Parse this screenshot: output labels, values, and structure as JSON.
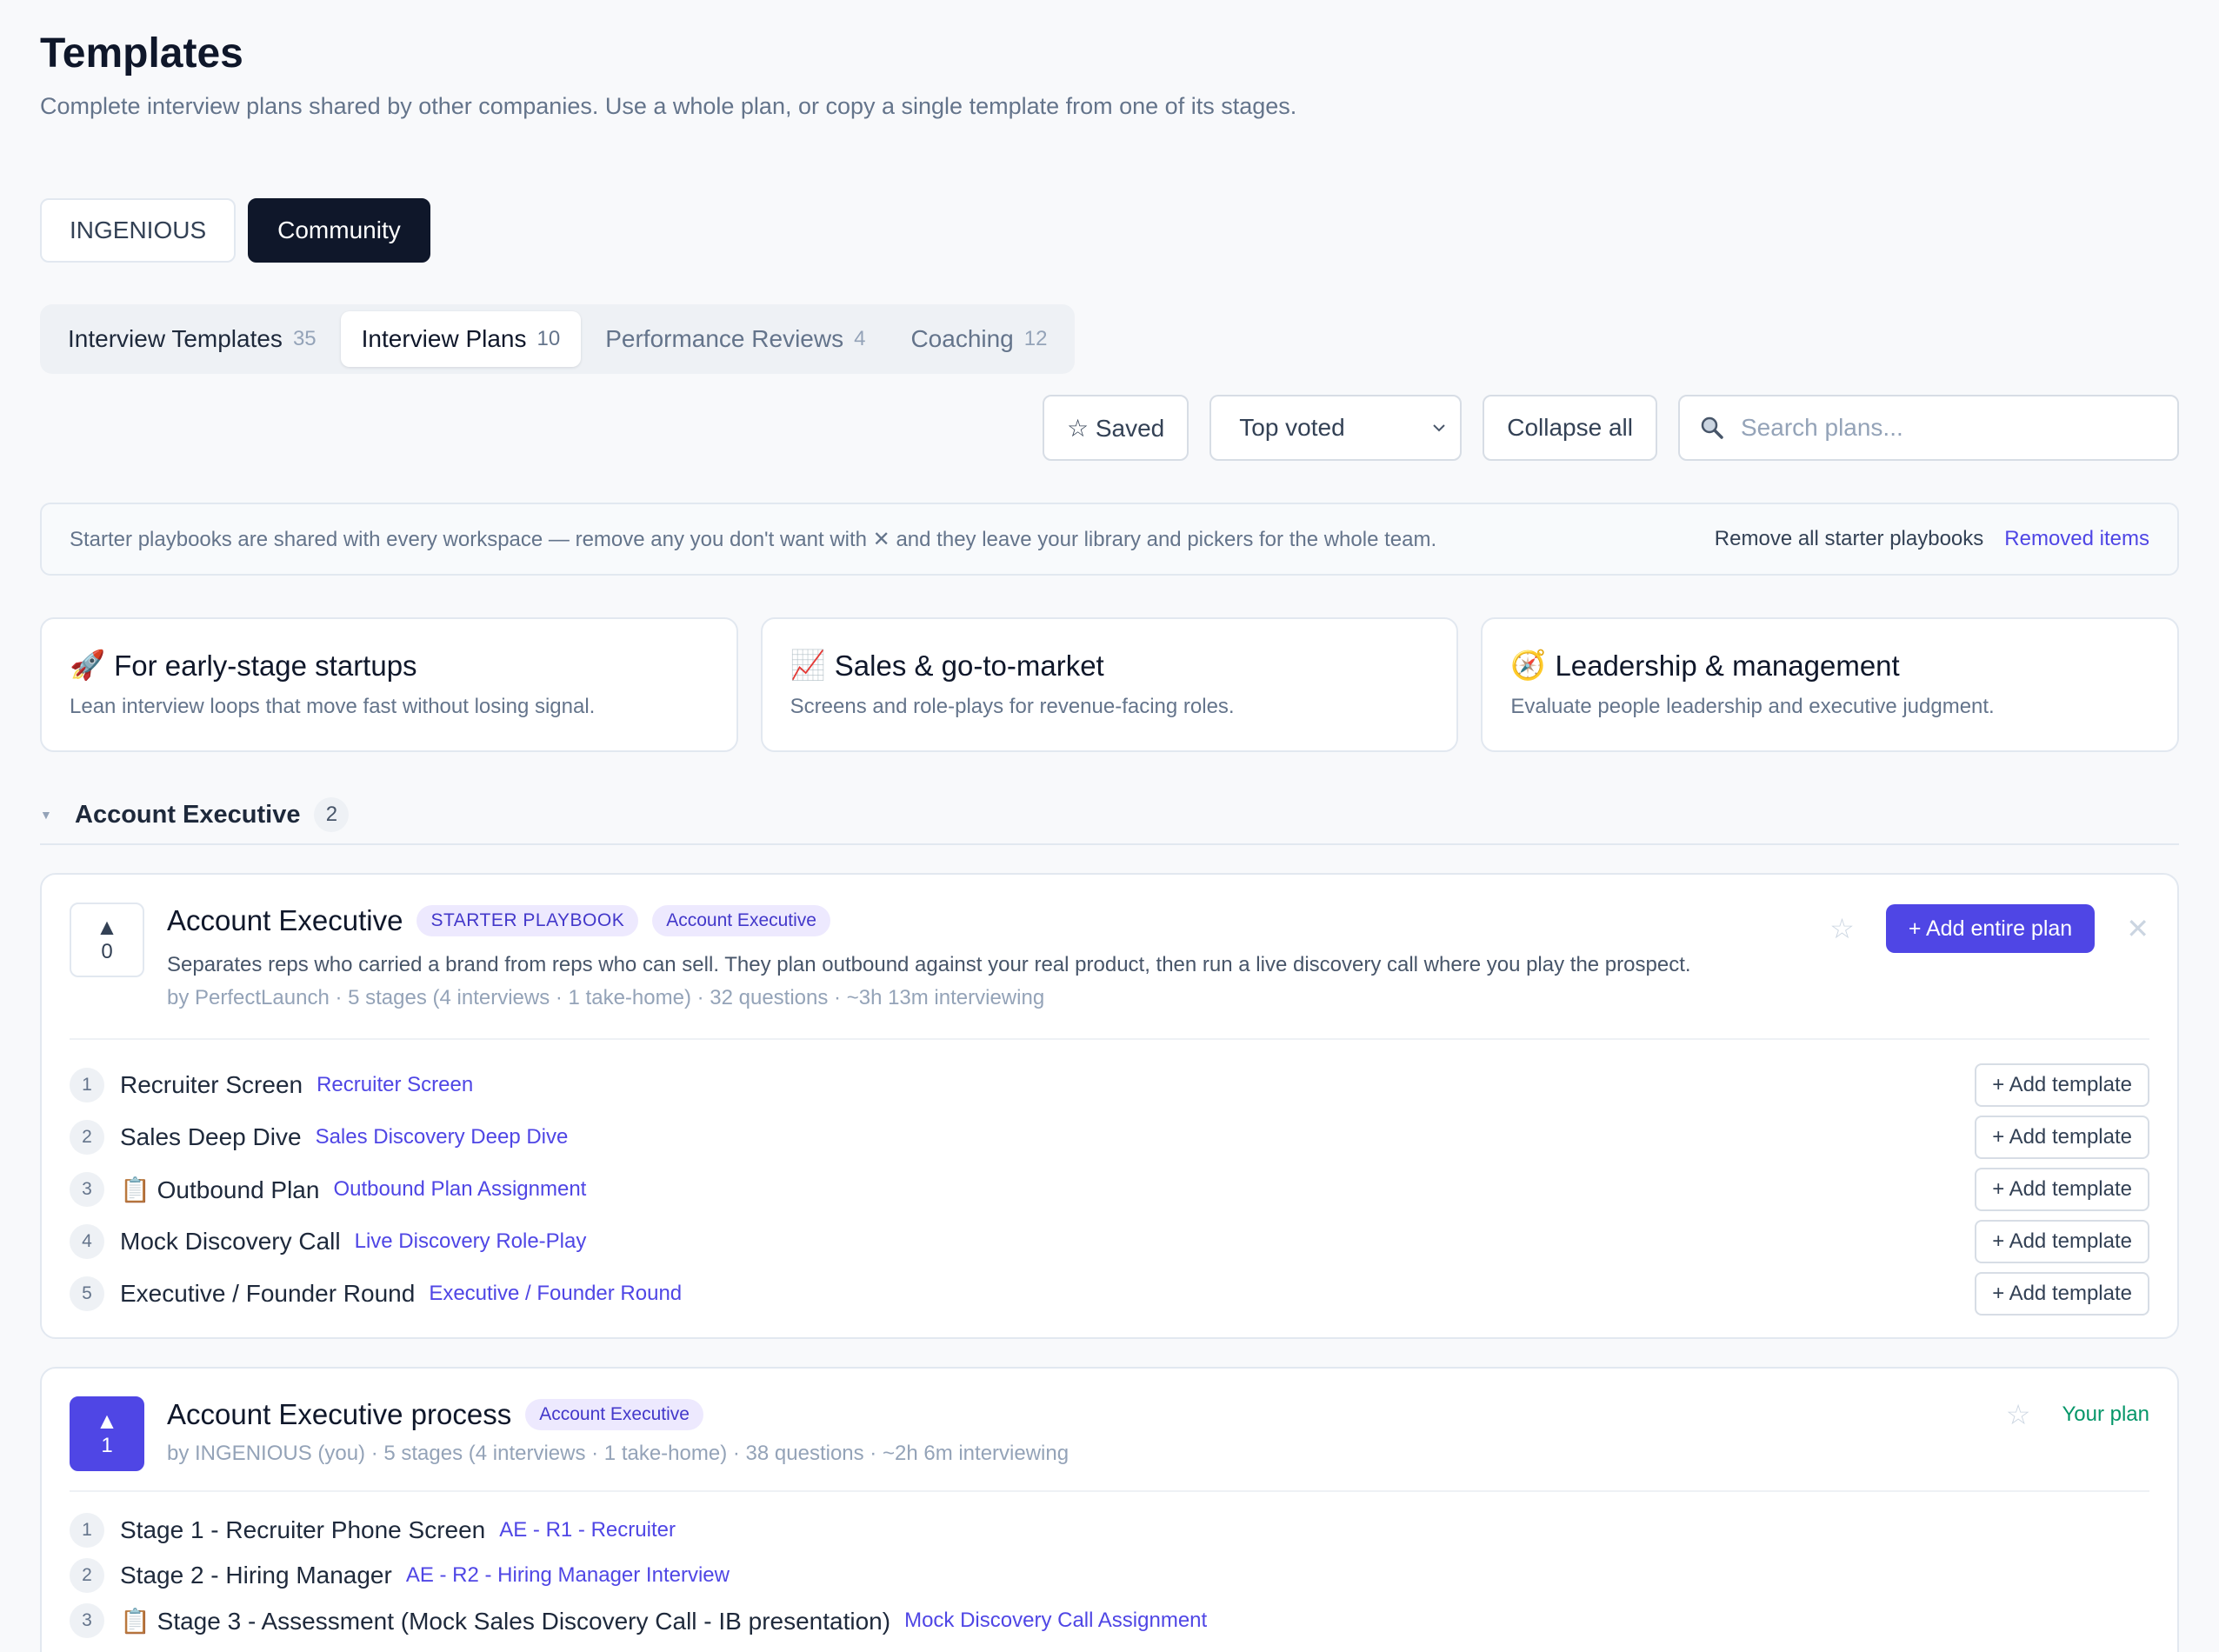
{
  "page": {
    "title": "Templates",
    "description": "Complete interview plans shared by other companies. Use a whole plan, or copy a single template from one of its stages."
  },
  "scope_toggle": [
    "INGENIOUS",
    "Community"
  ],
  "tabs": [
    {
      "label": "Interview Templates",
      "count": "35"
    },
    {
      "label": "Interview Plans",
      "count": "10"
    },
    {
      "label": "Performance Reviews",
      "count": "4"
    },
    {
      "label": "Coaching",
      "count": "12"
    }
  ],
  "toolbar": {
    "saved_label": "☆ Saved",
    "sort_value": "Top voted",
    "collapse_label": "Collapse all",
    "search_placeholder": "Search plans..."
  },
  "notice": {
    "text": "Starter playbooks are shared with every workspace — remove any you don't want with ✕ and they leave your library and pickers for the whole team.",
    "remove_all": "Remove all starter playbooks",
    "removed_items": "Removed items"
  },
  "categories": [
    {
      "emoji": "🚀",
      "title": "For early-stage startups",
      "desc": "Lean interview loops that move fast without losing signal."
    },
    {
      "emoji": "📈",
      "title": "Sales & go-to-market",
      "desc": "Screens and role-plays for revenue-facing roles."
    },
    {
      "emoji": "🧭",
      "title": "Leadership & management",
      "desc": "Evaluate people leadership and executive judgment."
    }
  ],
  "group": {
    "name": "Account Executive",
    "count": "2"
  },
  "plans": [
    {
      "votes": "0",
      "title": "Account Executive",
      "badge_starter": "STARTER PLAYBOOK",
      "badge_role": "Account Executive",
      "description": "Separates reps who carried a brand from reps who can sell. They plan outbound against your real product, then run a live discovery call where you play the prospect.",
      "meta": "by PerfectLaunch · 5 stages (4 interviews · 1 take-home) · 32 questions · ~3h 13m interviewing",
      "add_plan_label": "+ Add entire plan",
      "add_template_label": "+ Add template",
      "stages": [
        {
          "n": "1",
          "name": "Recruiter Screen",
          "template": "Recruiter Screen"
        },
        {
          "n": "2",
          "name": "Sales Deep Dive",
          "template": "Sales Discovery Deep Dive"
        },
        {
          "n": "3",
          "name": "📋 Outbound Plan",
          "template": "Outbound Plan Assignment"
        },
        {
          "n": "4",
          "name": "Mock Discovery Call",
          "template": "Live Discovery Role-Play"
        },
        {
          "n": "5",
          "name": "Executive / Founder Round",
          "template": "Executive / Founder Round"
        }
      ]
    },
    {
      "votes": "1",
      "title": "Account Executive process",
      "badge_role": "Account Executive",
      "meta": "by INGENIOUS (you) · 5 stages (4 interviews · 1 take-home) · 38 questions · ~2h 6m interviewing",
      "status": "Your plan",
      "stages": [
        {
          "n": "1",
          "name": "Stage 1 - Recruiter Phone Screen",
          "template": "AE - R1 - Recruiter"
        },
        {
          "n": "2",
          "name": "Stage 2 - Hiring Manager",
          "template": "AE - R2 - Hiring Manager Interview"
        },
        {
          "n": "3",
          "name": "📋 Stage 3 - Assessment (Mock Sales Discovery Call - IB presentation)",
          "template": "Mock Discovery Call Assignment"
        }
      ]
    }
  ],
  "colors": {
    "accent": "#4f46e5",
    "dark": "#0f172a",
    "success": "#059669"
  }
}
